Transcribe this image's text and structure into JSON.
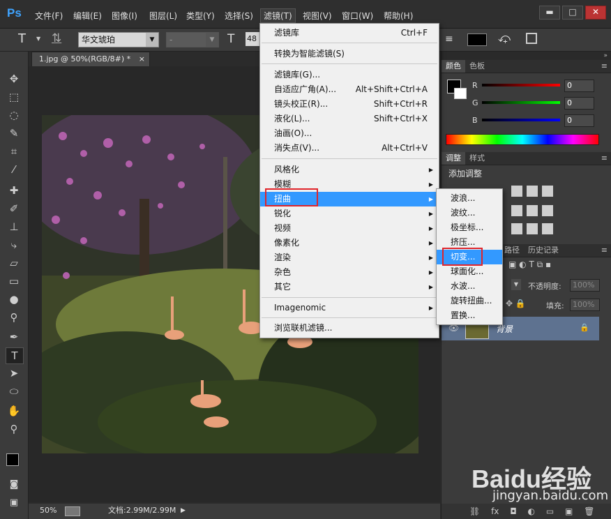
{
  "app": {
    "logo": "Ps"
  },
  "menubar": {
    "items": [
      "文件(F)",
      "编辑(E)",
      "图像(I)",
      "图层(L)",
      "类型(Y)",
      "选择(S)",
      "滤镜(T)",
      "视图(V)",
      "窗口(W)",
      "帮助(H)"
    ],
    "active": "滤镜(T)"
  },
  "window": {
    "minimize": "▬",
    "maximize": "□",
    "close": "✕"
  },
  "options": {
    "tool_glyph": "T",
    "font_family": "华文琥珀",
    "font_style": "-",
    "font_size": "48"
  },
  "document": {
    "tab_title": "1.jpg @ 50%(RGB/8#) *",
    "close": "×",
    "zoom": "50%",
    "doc_info": "文档:2.99M/2.99M"
  },
  "filter_menu": {
    "items": [
      {
        "label": "滤镜库",
        "shortcut": "Ctrl+F"
      },
      {
        "label": "转换为智能滤镜(S)",
        "shortcut": ""
      },
      {
        "label": "滤镜库(G)...",
        "shortcut": ""
      },
      {
        "label": "自适应广角(A)...",
        "shortcut": "Alt+Shift+Ctrl+A"
      },
      {
        "label": "镜头校正(R)...",
        "shortcut": "Shift+Ctrl+R"
      },
      {
        "label": "液化(L)...",
        "shortcut": "Shift+Ctrl+X"
      },
      {
        "label": "油画(O)...",
        "shortcut": ""
      },
      {
        "label": "消失点(V)...",
        "shortcut": "Alt+Ctrl+V"
      },
      {
        "label": "风格化",
        "shortcut": ""
      },
      {
        "label": "模糊",
        "shortcut": ""
      },
      {
        "label": "扭曲",
        "shortcut": ""
      },
      {
        "label": "锐化",
        "shortcut": ""
      },
      {
        "label": "视频",
        "shortcut": ""
      },
      {
        "label": "像素化",
        "shortcut": ""
      },
      {
        "label": "渲染",
        "shortcut": ""
      },
      {
        "label": "杂色",
        "shortcut": ""
      },
      {
        "label": "其它",
        "shortcut": ""
      },
      {
        "label": "Imagenomic",
        "shortcut": ""
      },
      {
        "label": "浏览联机滤镜...",
        "shortcut": ""
      }
    ],
    "highlighted": "扭曲"
  },
  "distort_submenu": {
    "items": [
      "波浪...",
      "波纹...",
      "极坐标...",
      "挤压...",
      "切变...",
      "球面化...",
      "水波...",
      "旋转扭曲...",
      "置换..."
    ],
    "highlighted": "切变..."
  },
  "color_panel": {
    "tabs": [
      "颜色",
      "色板"
    ],
    "channels": [
      {
        "label": "R",
        "value": "0"
      },
      {
        "label": "G",
        "value": "0"
      },
      {
        "label": "B",
        "value": "0"
      }
    ]
  },
  "adjust_panel": {
    "tabs": [
      "调整",
      "样式"
    ],
    "heading": "添加调整"
  },
  "layers_panel": {
    "tabs": [
      "路径",
      "历史记录"
    ],
    "opacity_label": "不透明度:",
    "opacity_value": "100%",
    "fill_label": "填充:",
    "fill_value": "100%",
    "layer_name": "背景"
  },
  "watermark": {
    "brand": "Baidu经验",
    "url": "jingyan.baidu.com"
  },
  "colors": {
    "highlight": "#3399ff",
    "callout": "#e0242a",
    "ps_blue": "#3fa4ff"
  }
}
